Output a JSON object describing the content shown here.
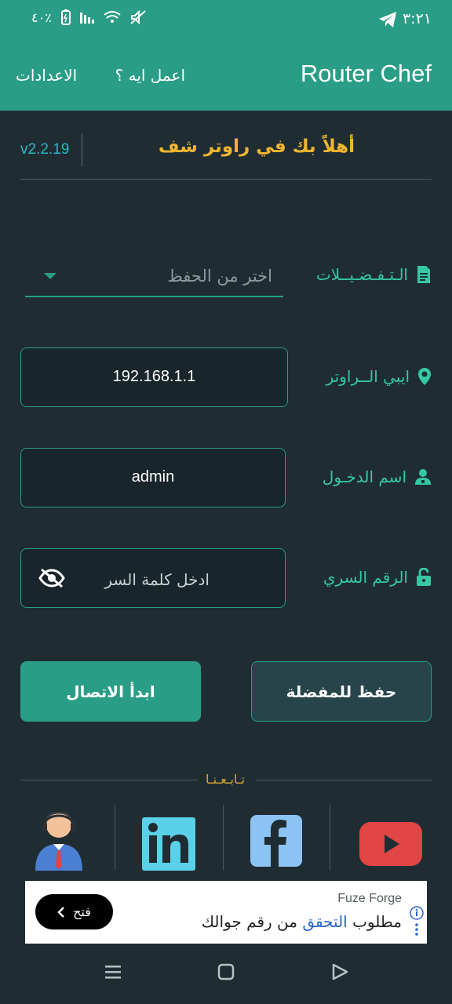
{
  "status_bar": {
    "time": "٣:٢١",
    "battery": "٤٠٪"
  },
  "app_bar": {
    "title": "Router Chef",
    "what_to_do": "اعمل ايه ؟",
    "settings": "الاعدادات"
  },
  "header": {
    "version": "v2.2.19",
    "welcome": "أهلاً بك في راوتر شف"
  },
  "form": {
    "favorites_label": "الـتـفـضـيــلات",
    "favorites_placeholder": "اختر من الحفظ",
    "router_ip_label": "ايبي الــراوتر",
    "router_ip_value": "192.168.1.1",
    "username_label": "اسم الدخـول",
    "username_value": "admin",
    "password_label": "الرقم السري",
    "password_placeholder": "ادخل كلمة السر"
  },
  "actions": {
    "connect": "ابدأ الاتصال",
    "save_favorite": "حفظ للمفضلة"
  },
  "follow": {
    "label": "تـابـعـنـا",
    "items": [
      "youtube",
      "facebook",
      "linkedin",
      "support"
    ]
  },
  "ad": {
    "brand": "Fuze Forge",
    "text_before": "مطلوب ",
    "text_highlight": "التحقق",
    "text_after": " من رقم جوالك",
    "open_button": "فتح"
  },
  "colors": {
    "primary": "#2a9d86",
    "background": "#1f2d33",
    "accent_yellow": "#f2b52e",
    "label_teal": "#35c8a3"
  }
}
